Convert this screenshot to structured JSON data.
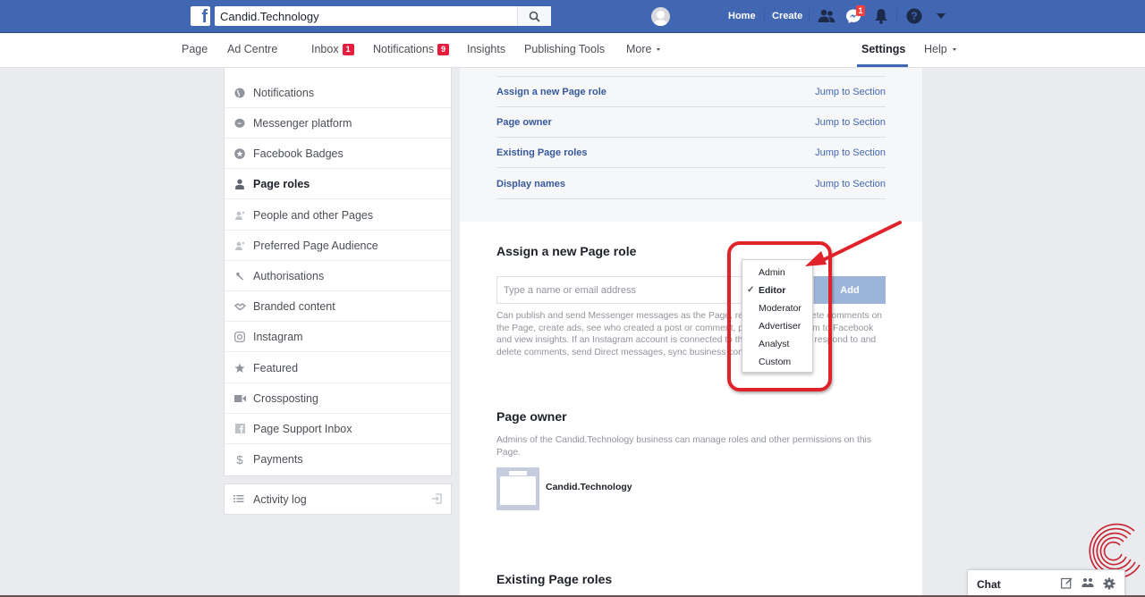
{
  "topbar": {
    "search_value": "Candid.Technology",
    "links": {
      "home": "Home",
      "create": "Create"
    },
    "messenger_badge": "1",
    "icons": [
      "facebook-logo",
      "search-icon",
      "avatar",
      "friends-icon",
      "messenger-icon",
      "bell-icon",
      "help-icon",
      "caret-down-icon"
    ]
  },
  "pagenav": {
    "items": [
      {
        "label": "Page"
      },
      {
        "label": "Ad Centre"
      },
      {
        "label": "Inbox",
        "badge": "1"
      },
      {
        "label": "Notifications",
        "badge": "9"
      },
      {
        "label": "Insights"
      },
      {
        "label": "Publishing Tools"
      },
      {
        "label": "More"
      }
    ],
    "settings": "Settings",
    "help": "Help"
  },
  "sidebar": {
    "items": [
      {
        "label": "Notifications",
        "icon": "globe-icon"
      },
      {
        "label": "Messenger platform",
        "icon": "messenger-icon"
      },
      {
        "label": "Facebook Badges",
        "icon": "badge-icon"
      },
      {
        "label": "Page roles",
        "icon": "person-icon",
        "active": true
      },
      {
        "label": "People and other Pages",
        "icon": "people-icon"
      },
      {
        "label": "Preferred Page Audience",
        "icon": "people-icon"
      },
      {
        "label": "Authorisations",
        "icon": "wrench-icon"
      },
      {
        "label": "Branded content",
        "icon": "handshake-icon"
      },
      {
        "label": "Instagram",
        "icon": "instagram-icon"
      },
      {
        "label": "Featured",
        "icon": "star-icon"
      },
      {
        "label": "Crossposting",
        "icon": "video-icon"
      },
      {
        "label": "Page Support Inbox",
        "icon": "facebook-icon"
      },
      {
        "label": "Payments",
        "icon": "dollar-icon"
      }
    ],
    "activity_log": "Activity log"
  },
  "main": {
    "toc": [
      {
        "title": "Assign a new Page role",
        "link": "Jump to Section"
      },
      {
        "title": "Page owner",
        "link": "Jump to Section"
      },
      {
        "title": "Existing Page roles",
        "link": "Jump to Section"
      },
      {
        "title": "Display names",
        "link": "Jump to Section"
      }
    ],
    "assign": {
      "title": "Assign a new Page role",
      "placeholder": "Type a name or email address",
      "add_label": "Add",
      "description": "Can publish and send Messenger messages as the Page, respond to and delete comments on the Page, create ads, see who created a post or comment, post from Instagram to Facebook and view insights. If an Instagram account is connected to the Page, they can respond to and delete comments, send Direct messages, sync business contact info"
    },
    "owner": {
      "title": "Page owner",
      "description": "Admins of the Candid.Technology business can manage roles and other permissions on this Page.",
      "name": "Candid.Technology"
    },
    "existing": {
      "title": "Existing Page roles"
    }
  },
  "role_dropdown": {
    "options": [
      "Admin",
      "Editor",
      "Moderator",
      "Advertiser",
      "Analyst",
      "Custom"
    ],
    "selected": "Editor"
  },
  "chat": {
    "label": "Chat"
  },
  "colors": {
    "brand": "#4267b2",
    "link": "#365899",
    "badge": "#e41e3f",
    "annotation": "#e0232b",
    "add_button": "#9cb4d8"
  }
}
